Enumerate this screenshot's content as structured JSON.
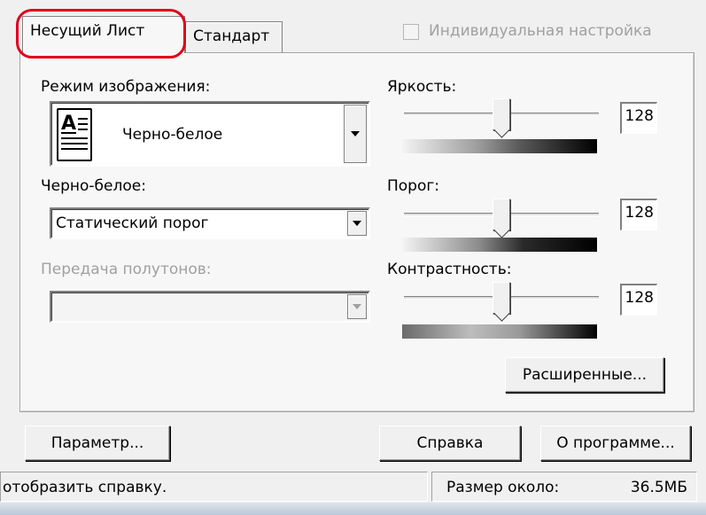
{
  "tabs": [
    {
      "label": "Несущий Лист",
      "active": true
    },
    {
      "label": "Стандарт",
      "active": false
    }
  ],
  "individual_setting": {
    "label": "Индивидуальная настройка",
    "checked": false,
    "enabled": false
  },
  "image_mode": {
    "label": "Режим изображения:",
    "value": "Черно-белое",
    "icon": "document-text-icon"
  },
  "bw": {
    "label": "Черно-белое:",
    "value": "Статический порог"
  },
  "halftone": {
    "label": "Передача полутонов:",
    "value": "",
    "enabled": false
  },
  "brightness": {
    "label": "Яркость:",
    "value": "128",
    "level": 128,
    "max": 255
  },
  "threshold": {
    "label": "Порог:",
    "value": "128",
    "level": 128,
    "max": 255
  },
  "contrast": {
    "label": "Контрастность:",
    "value": "128",
    "level": 128,
    "max": 255
  },
  "buttons": {
    "advanced": "Расширенные...",
    "parameter": "Параметр...",
    "help": "Справка",
    "about": "О программе..."
  },
  "status": {
    "message": "отобразить справку.",
    "size_label": "Размер около:",
    "size_value": "36.5МБ"
  },
  "colors": {
    "highlight": "#e0001b",
    "panel": "#f7f7f7",
    "window": "#f0f0f0"
  }
}
